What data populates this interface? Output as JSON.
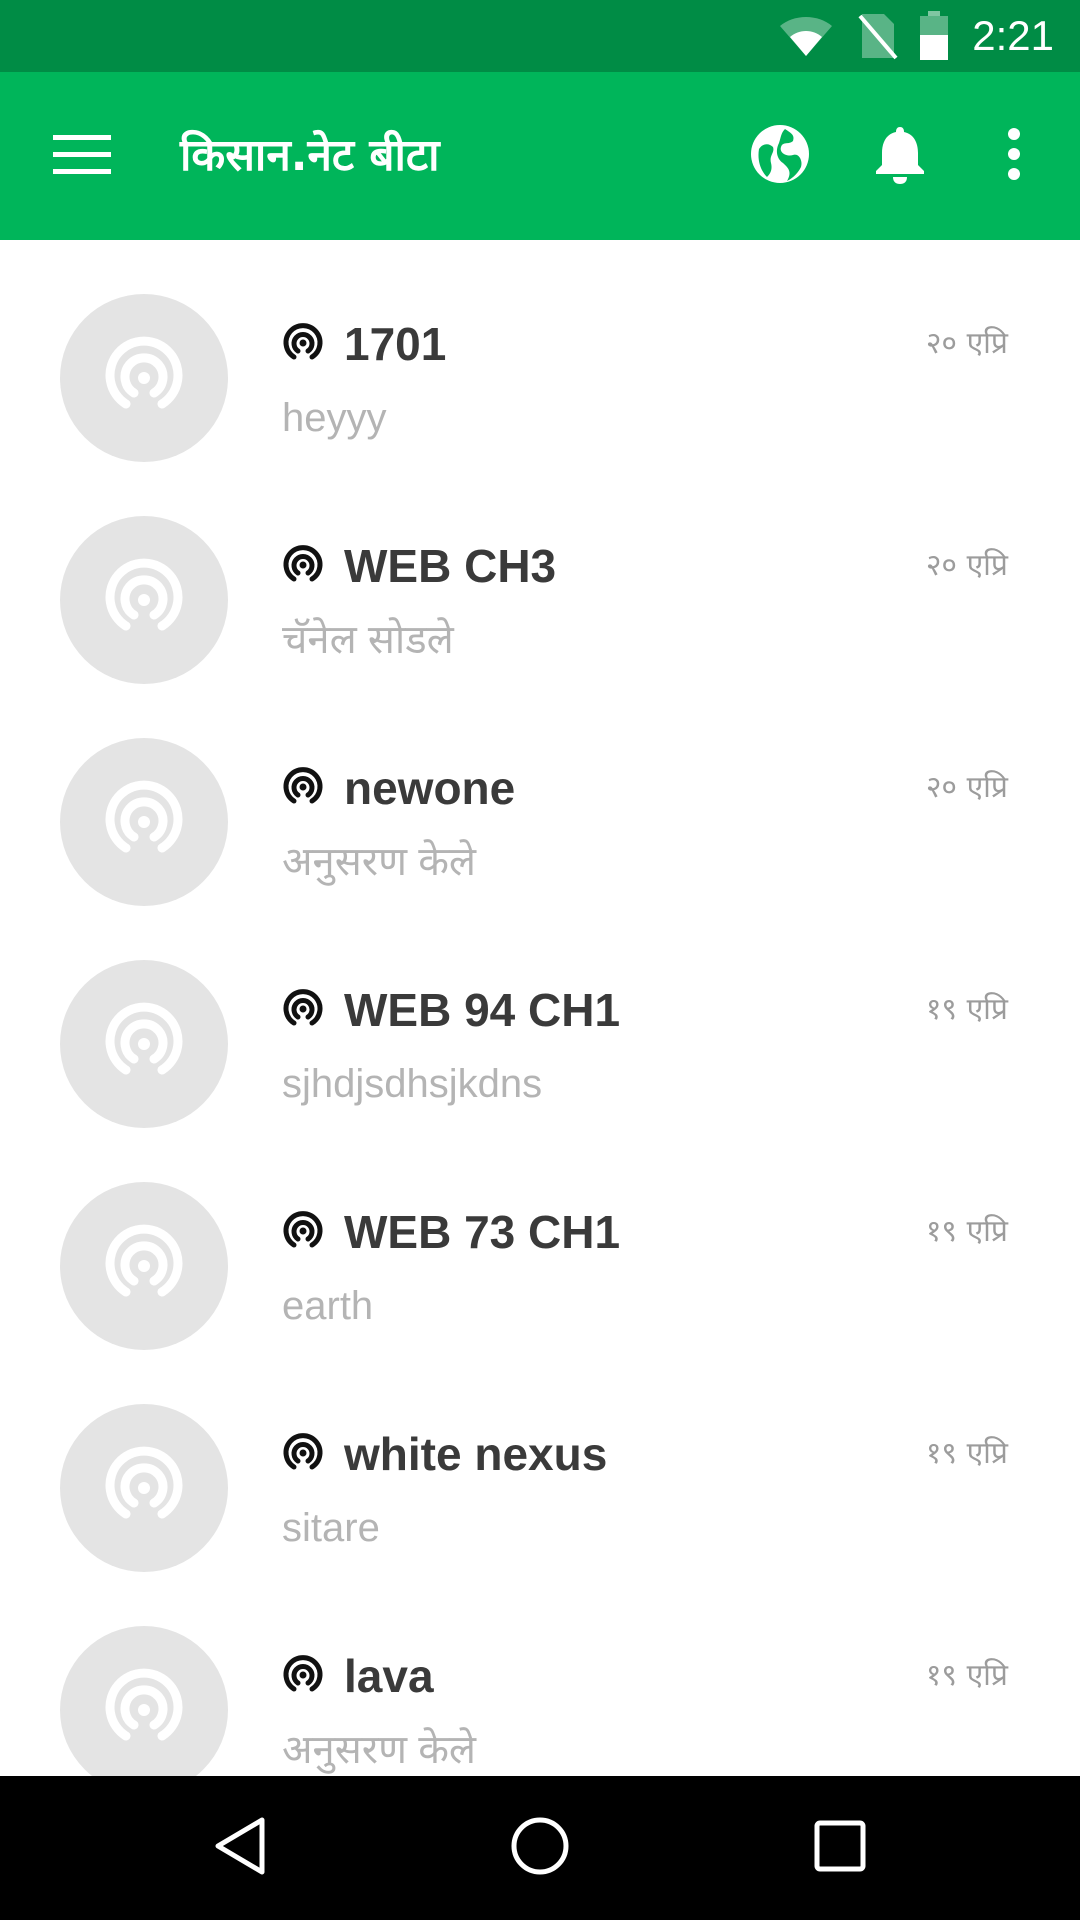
{
  "status_bar": {
    "time": "2:21",
    "icons": [
      "wifi-icon",
      "no-sim-icon",
      "battery-icon"
    ]
  },
  "app_bar": {
    "title": "किसान.नेट बीटा",
    "icons": [
      "menu-icon",
      "globe-icon",
      "bell-icon",
      "more-vert-icon"
    ],
    "background_color": "#00b55a",
    "status_color": "#008c45"
  },
  "channels": [
    {
      "title": "1701",
      "subtitle": "heyyy",
      "date": "२० एप्रि"
    },
    {
      "title": "WEB CH3",
      "subtitle": "चॅनेल सोडले",
      "date": "२० एप्रि"
    },
    {
      "title": "newone",
      "subtitle": "अनुसरण केले",
      "date": "२० एप्रि"
    },
    {
      "title": "WEB 94 CH1",
      "subtitle": "sjhdjsdhsjkdns",
      "date": "१९ एप्रि"
    },
    {
      "title": "WEB 73 CH1",
      "subtitle": "earth",
      "date": "१९ एप्रि"
    },
    {
      "title": "white nexus",
      "subtitle": "sitare",
      "date": "१९ एप्रि"
    },
    {
      "title": "lava",
      "subtitle": "अनुसरण केले",
      "date": "१९ एप्रि"
    }
  ],
  "nav_bar": {
    "icons": [
      "back-icon",
      "home-icon",
      "recents-icon"
    ]
  }
}
